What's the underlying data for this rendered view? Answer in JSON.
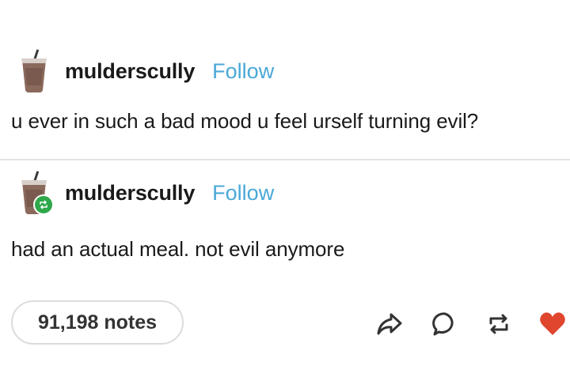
{
  "posts": [
    {
      "username": "mulderscully",
      "follow_label": "Follow",
      "text": "u ever in such a bad mood u feel urself turning evil?",
      "reblog": false
    },
    {
      "username": "mulderscully",
      "follow_label": "Follow",
      "text": "had an actual meal. not evil anymore",
      "reblog": true
    }
  ],
  "footer": {
    "notes_label": "91,198 notes"
  },
  "actions": [
    {
      "icon": "share-icon"
    },
    {
      "icon": "reply-icon"
    },
    {
      "icon": "reblog-icon"
    },
    {
      "icon": "like-icon"
    }
  ],
  "colors": {
    "follow": "#4aa8d8",
    "reblog_badge": "#2ea84a",
    "like": "#e0452e"
  }
}
